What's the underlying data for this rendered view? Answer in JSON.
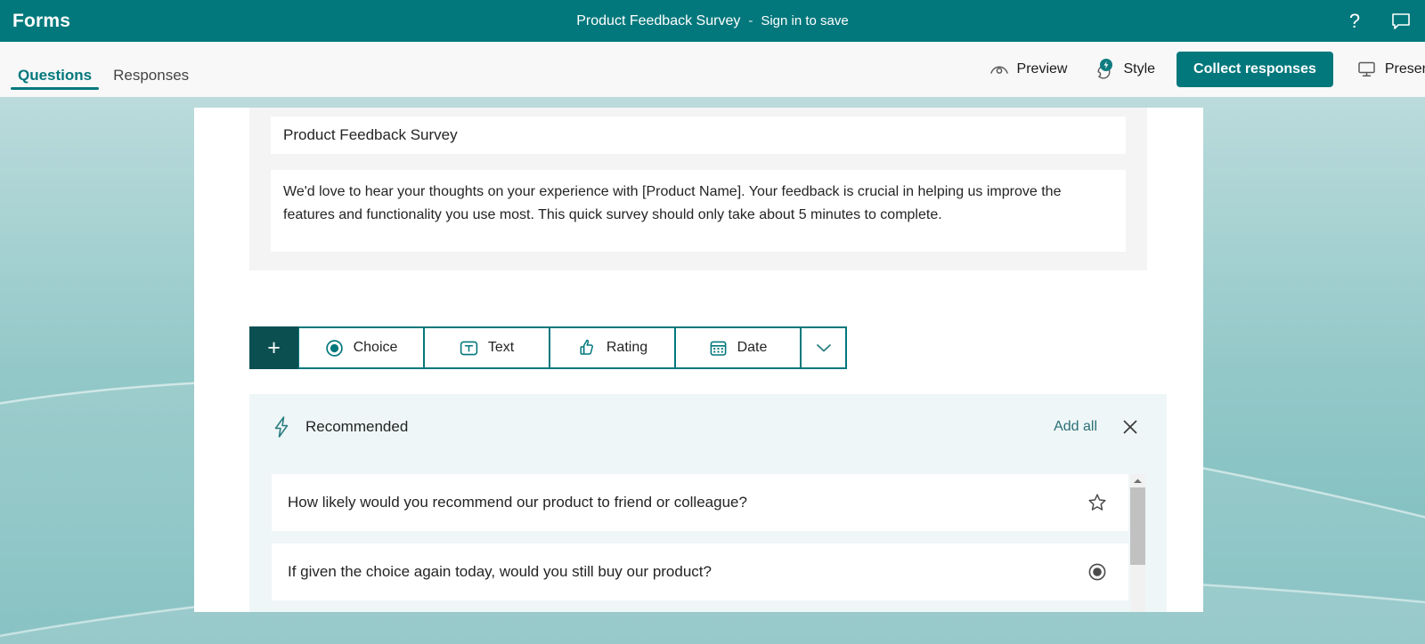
{
  "app": {
    "brand": "Forms",
    "form_title_top": "Product Feedback Survey",
    "separator": "-",
    "sign_in_label": "Sign in to save",
    "help_icon": "help-question-icon",
    "feedback_icon": "feedback-speech-bubble-icon"
  },
  "command_bar": {
    "tabs": [
      {
        "label": "Questions",
        "active": true
      },
      {
        "label": "Responses",
        "active": false
      }
    ],
    "preview_label": "Preview",
    "preview_icon": "eye-preview-icon",
    "style_label": "Style",
    "style_icon": "style-palette-lightning-icon",
    "collect_label": "Collect responses",
    "present_label": "Present",
    "present_icon": "present-screen-icon"
  },
  "form": {
    "title_value": "Product Feedback Survey",
    "description_value": "We'd love to hear your thoughts on your experience with [Product Name]. Your feedback is crucial in helping us improve the features and functionality you use most. This quick survey should only take about 5 minutes to complete."
  },
  "add_question_bar": {
    "plus_label": "+",
    "types": [
      {
        "label": "Choice",
        "icon": "radio-choice-icon"
      },
      {
        "label": "Text",
        "icon": "text-t-box-icon"
      },
      {
        "label": "Rating",
        "icon": "thumbs-up-rating-icon"
      },
      {
        "label": "Date",
        "icon": "calendar-date-icon"
      }
    ],
    "more_icon": "chevron-down-icon"
  },
  "recommended": {
    "title": "Recommended",
    "header_icon": "lightning-bolt-icon",
    "add_all_label": "Add all",
    "close_icon": "close-x-icon",
    "items": [
      {
        "text": "How likely would you recommend our product to friend or colleague?",
        "icon": "star-rating-icon"
      },
      {
        "text": "If given the choice again today, would you still buy our product?",
        "icon": "radio-choice-icon"
      }
    ],
    "scrollbar": {
      "up_icon": "scroll-up-arrow-icon"
    }
  },
  "colors": {
    "brand_teal": "#03787c",
    "dark_teal": "#0b4f51",
    "panel_bg": "#ffffff",
    "card_bg": "#f4f4f4",
    "recommended_bg": "#eff6f7",
    "wallpaper_top": "#c4dfe0",
    "wallpaper_bottom": "#7bbcbd"
  }
}
